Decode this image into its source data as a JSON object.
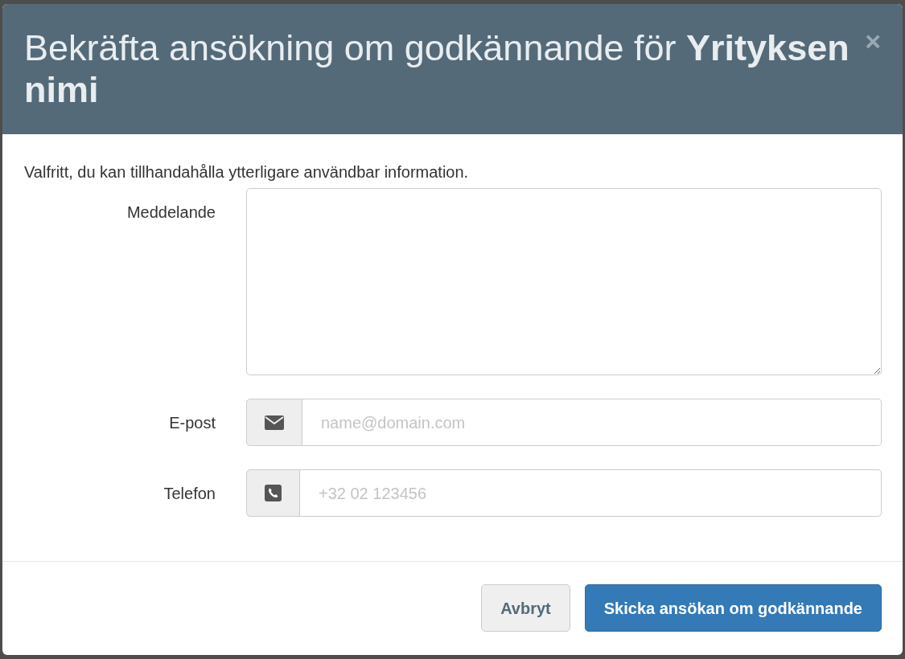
{
  "dialog": {
    "title": "Bekräfta ansökning om godkännande för **Yrityksen nimi**",
    "close": "×"
  },
  "intro": "Valfritt, du kan tillhandahålla ytterligare användbar information.",
  "fields": [
    {
      "kind": "textarea",
      "label": "Meddelande"
    },
    {
      "kind": "email",
      "label": "E-post",
      "placeholder": "name@domain.com"
    },
    {
      "kind": "phone",
      "label": "Telefon",
      "placeholder": "+32 02 123456"
    }
  ],
  "buttons": [
    {
      "kind": "secondary",
      "label": "Avbryt"
    },
    {
      "kind": "primary",
      "label": "Skicka ansökan om godkännande"
    }
  ]
}
